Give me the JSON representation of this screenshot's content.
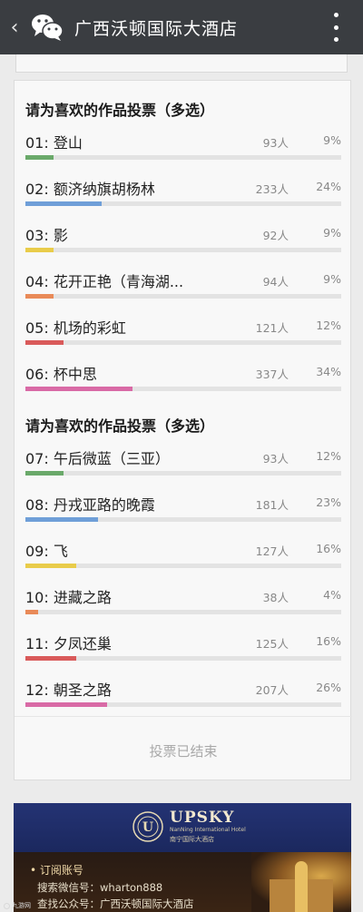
{
  "header": {
    "back_icon": "chevron-left-icon",
    "app_icon": "wechat-icon",
    "title": "广西沃顿国际大酒店",
    "more_icon": "more-vertical-icon",
    "background": "#3a3d41"
  },
  "vote": {
    "groups": [
      {
        "title": "请为喜欢的作品投票（多选）",
        "items": [
          {
            "label": "01: 登山",
            "count": "93人",
            "pct": "9%",
            "fill": 0.09,
            "color": "#6aa96a"
          },
          {
            "label": "02: 额济纳旗胡杨林",
            "count": "233人",
            "pct": "24%",
            "fill": 0.24,
            "color": "#6f9fd8"
          },
          {
            "label": "03: 影",
            "count": "92人",
            "pct": "9%",
            "fill": 0.09,
            "color": "#e9cc4a"
          },
          {
            "label": "04: 花开正艳（青海湖...",
            "count": "94人",
            "pct": "9%",
            "fill": 0.09,
            "color": "#e98a58"
          },
          {
            "label": "05: 机场的彩虹",
            "count": "121人",
            "pct": "12%",
            "fill": 0.12,
            "color": "#d95a5a"
          },
          {
            "label": "06: 杯中思",
            "count": "337人",
            "pct": "34%",
            "fill": 0.34,
            "color": "#d96aa6"
          }
        ]
      },
      {
        "title": "请为喜欢的作品投票（多选）",
        "items": [
          {
            "label": "07: 午后微蓝（三亚）",
            "count": "93人",
            "pct": "12%",
            "fill": 0.12,
            "color": "#6aa96a"
          },
          {
            "label": "08: 丹戎亚路的晚霞",
            "count": "181人",
            "pct": "23%",
            "fill": 0.23,
            "color": "#6f9fd8"
          },
          {
            "label": "09: 飞",
            "count": "127人",
            "pct": "16%",
            "fill": 0.16,
            "color": "#e9cc4a"
          },
          {
            "label": "10: 进藏之路",
            "count": "38人",
            "pct": "4%",
            "fill": 0.04,
            "color": "#e98a58"
          },
          {
            "label": "11: 夕凤还巢",
            "count": "125人",
            "pct": "16%",
            "fill": 0.16,
            "color": "#d95a5a"
          },
          {
            "label": "12: 朝圣之路",
            "count": "207人",
            "pct": "26%",
            "fill": 0.26,
            "color": "#d96aa6"
          }
        ]
      }
    ],
    "ended_text": "投票已结束"
  },
  "banner": {
    "brand": "UPSKY",
    "brand_sub": "NanNing International Hotel",
    "brand_cn": "南宁国际大酒店",
    "subscribe_title": "• 订阅账号",
    "search_line": "搜索微信号：wharton888",
    "public_line": "查找公众号：广西沃顿国际大酒店"
  },
  "watermark": "九游网"
}
